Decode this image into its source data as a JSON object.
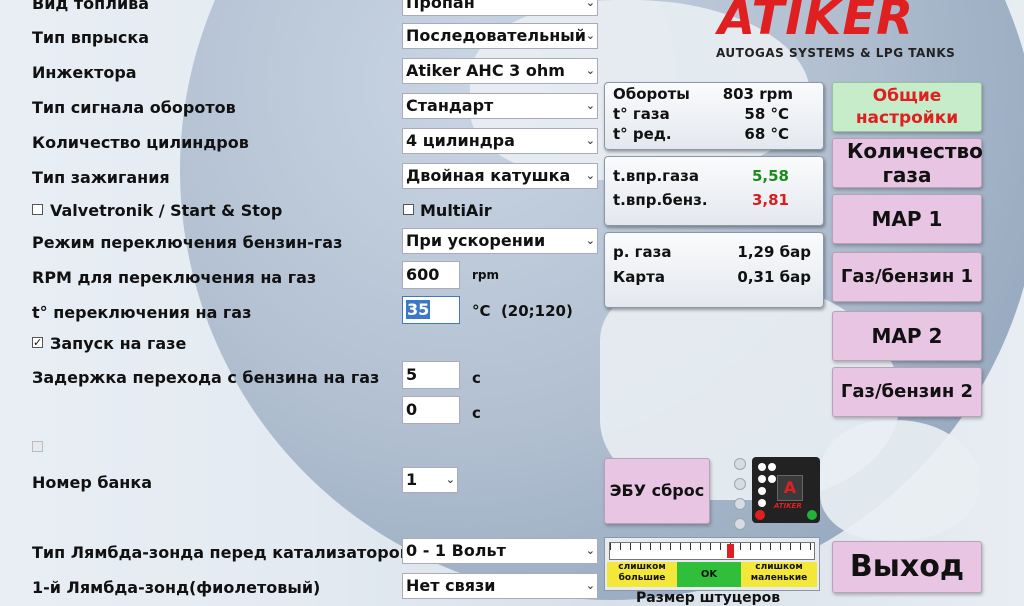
{
  "brand": {
    "logo": "ATIKER",
    "tagline": "AUTOGAS SYSTEMS & LPG TANKS"
  },
  "settings": [
    {
      "label": "Вид топлива",
      "value": "Пропан"
    },
    {
      "label": "Тип впрыска",
      "value": "Последовательный"
    },
    {
      "label": "Инжектора",
      "value": "Atiker AHC 3 ohm"
    },
    {
      "label": "Тип сигнала оборотов",
      "value": "Стандарт"
    },
    {
      "label": "Количество цилиндров",
      "value": "4 цилиндра"
    },
    {
      "label": "Тип зажигания",
      "value": "Двойная катушка"
    },
    {
      "label": "Режим переключения бензин-газ",
      "value": "При ускорении"
    },
    {
      "label": "RPM для переключения на газ",
      "value": "600",
      "unit": "rpm"
    },
    {
      "label": "t° переключения на газ",
      "value": "35",
      "unit": "°C  (20;120)"
    },
    {
      "label": "Задержка перехода с бензина на газ",
      "value": "5",
      "unit": "с"
    },
    {
      "label": "",
      "value": "0",
      "unit": "с"
    },
    {
      "label": "Номер банка",
      "value": "1"
    },
    {
      "label": "Тип Лямбда-зонда перед катализатором",
      "value": "0 - 1 Вольт"
    },
    {
      "label": "1-й Лямбда-зонд(фиолетовый)",
      "value": "Нет связи"
    }
  ],
  "checkboxes": {
    "valvetronik": {
      "label": "Valvetronik / Start & Stop",
      "checked": false
    },
    "multiair": {
      "label": "MultiAir",
      "checked": false
    },
    "start_on_gas": {
      "label": "Запуск на газе",
      "checked": true
    },
    "extra": {
      "label": "",
      "checked": false
    }
  },
  "panel1": [
    {
      "k": "Обороты",
      "v": "803 rpm"
    },
    {
      "k": "t° газа",
      "v": "58 °C"
    },
    {
      "k": "t° ред.",
      "v": "68 °C"
    }
  ],
  "panel2": [
    {
      "k": "t.впр.газа",
      "v": "5,58",
      "color": "#1a8c1a"
    },
    {
      "k": "t.впр.бенз.",
      "v": "3,81",
      "color": "#d42020"
    }
  ],
  "panel3": [
    {
      "k": "р. газа",
      "v": "1,29 бар"
    },
    {
      "k": "Карта",
      "v": "0,31 бар"
    }
  ],
  "buttons": {
    "general": "Общие настройки",
    "gas_qty": "Количество газа",
    "map1": "MAP 1",
    "gas_petrol1": "Газ/бензин 1",
    "map2": "MAP 2",
    "gas_petrol2": "Газ/бензин 2",
    "ecu_reset": "ЭБУ сброс",
    "exit": "Выход"
  },
  "nozzle": {
    "too_big": "слишком большие",
    "ok": "OK",
    "too_small": "слишком маленькие",
    "caption": "Размер штуцеров",
    "indicator": 0.58
  },
  "controller": {
    "logo": "ATIKER"
  },
  "colors": {
    "accent_red": "#e02020",
    "button_pink": "#e8c5e3",
    "button_green": "#c6ecc9"
  }
}
